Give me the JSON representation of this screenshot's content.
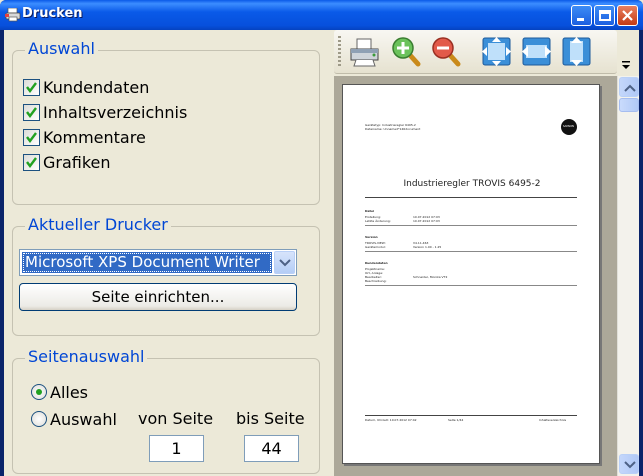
{
  "window": {
    "title": "Drucken"
  },
  "auswahl": {
    "title": "Auswahl",
    "items": [
      {
        "label": "Kundendaten",
        "checked": true
      },
      {
        "label": "Inhaltsverzeichnis",
        "checked": true
      },
      {
        "label": "Kommentare",
        "checked": true
      },
      {
        "label": "Grafiken",
        "checked": true
      }
    ]
  },
  "drucker": {
    "title": "Aktueller Drucker",
    "selected": "Microsoft XPS Document Writer",
    "setup_button": "Seite einrichten..."
  },
  "seitenauswahl": {
    "title": "Seitenauswahl",
    "alles_label": "Alles",
    "auswahl_label": "Auswahl",
    "von_label": "von Seite",
    "bis_label": "bis Seite",
    "von_value": "1",
    "bis_value": "44",
    "selected": "Alles"
  },
  "toolbar": {
    "tools": [
      "printer-icon",
      "zoom-in-icon",
      "zoom-out-icon",
      "fit-page-icon",
      "fit-width-icon",
      "fit-height-icon"
    ]
  },
  "preview_page": {
    "header_line1": "Gerätetyp: Industrieregler 6495-2",
    "header_line2": "Dateiname: Unnamed*146document",
    "doc_title": "Industrieregler TROVIS 6495-2",
    "logo": "SAMSON",
    "sec_datei": "Datei",
    "erstellung_label": "Erstellung:",
    "erstellung_value": "10.07.2012 07:03",
    "aenderung_label": "Letzte Änderung:",
    "aenderung_value": "10.07.2012 07:03",
    "sec_version": "Version",
    "trovis_label": "TROVIS-VIEW:",
    "trovis_value": "V4.11.463",
    "geraet_label": "Gerätemodul:",
    "geraet_value": "Version 1.00 - 1.25",
    "sec_kunden": "Kundendaten",
    "proj_label": "Projektname:",
    "anlage_label": "Ort, Anlage:",
    "bearb_label": "Bearbeiter:",
    "bearb_value": "Schneider, Monika VT2",
    "beschr_label": "Beschreibung:",
    "footer_left": "Datum, Uhrzeit: 10.07.2012 07:42",
    "footer_mid": "Seite 1/44",
    "footer_right": "Inhaltsverzeichnis"
  },
  "colors": {
    "group_title": "#0046d5",
    "selection": "#316ac5",
    "title_bar": "#0750dc"
  }
}
